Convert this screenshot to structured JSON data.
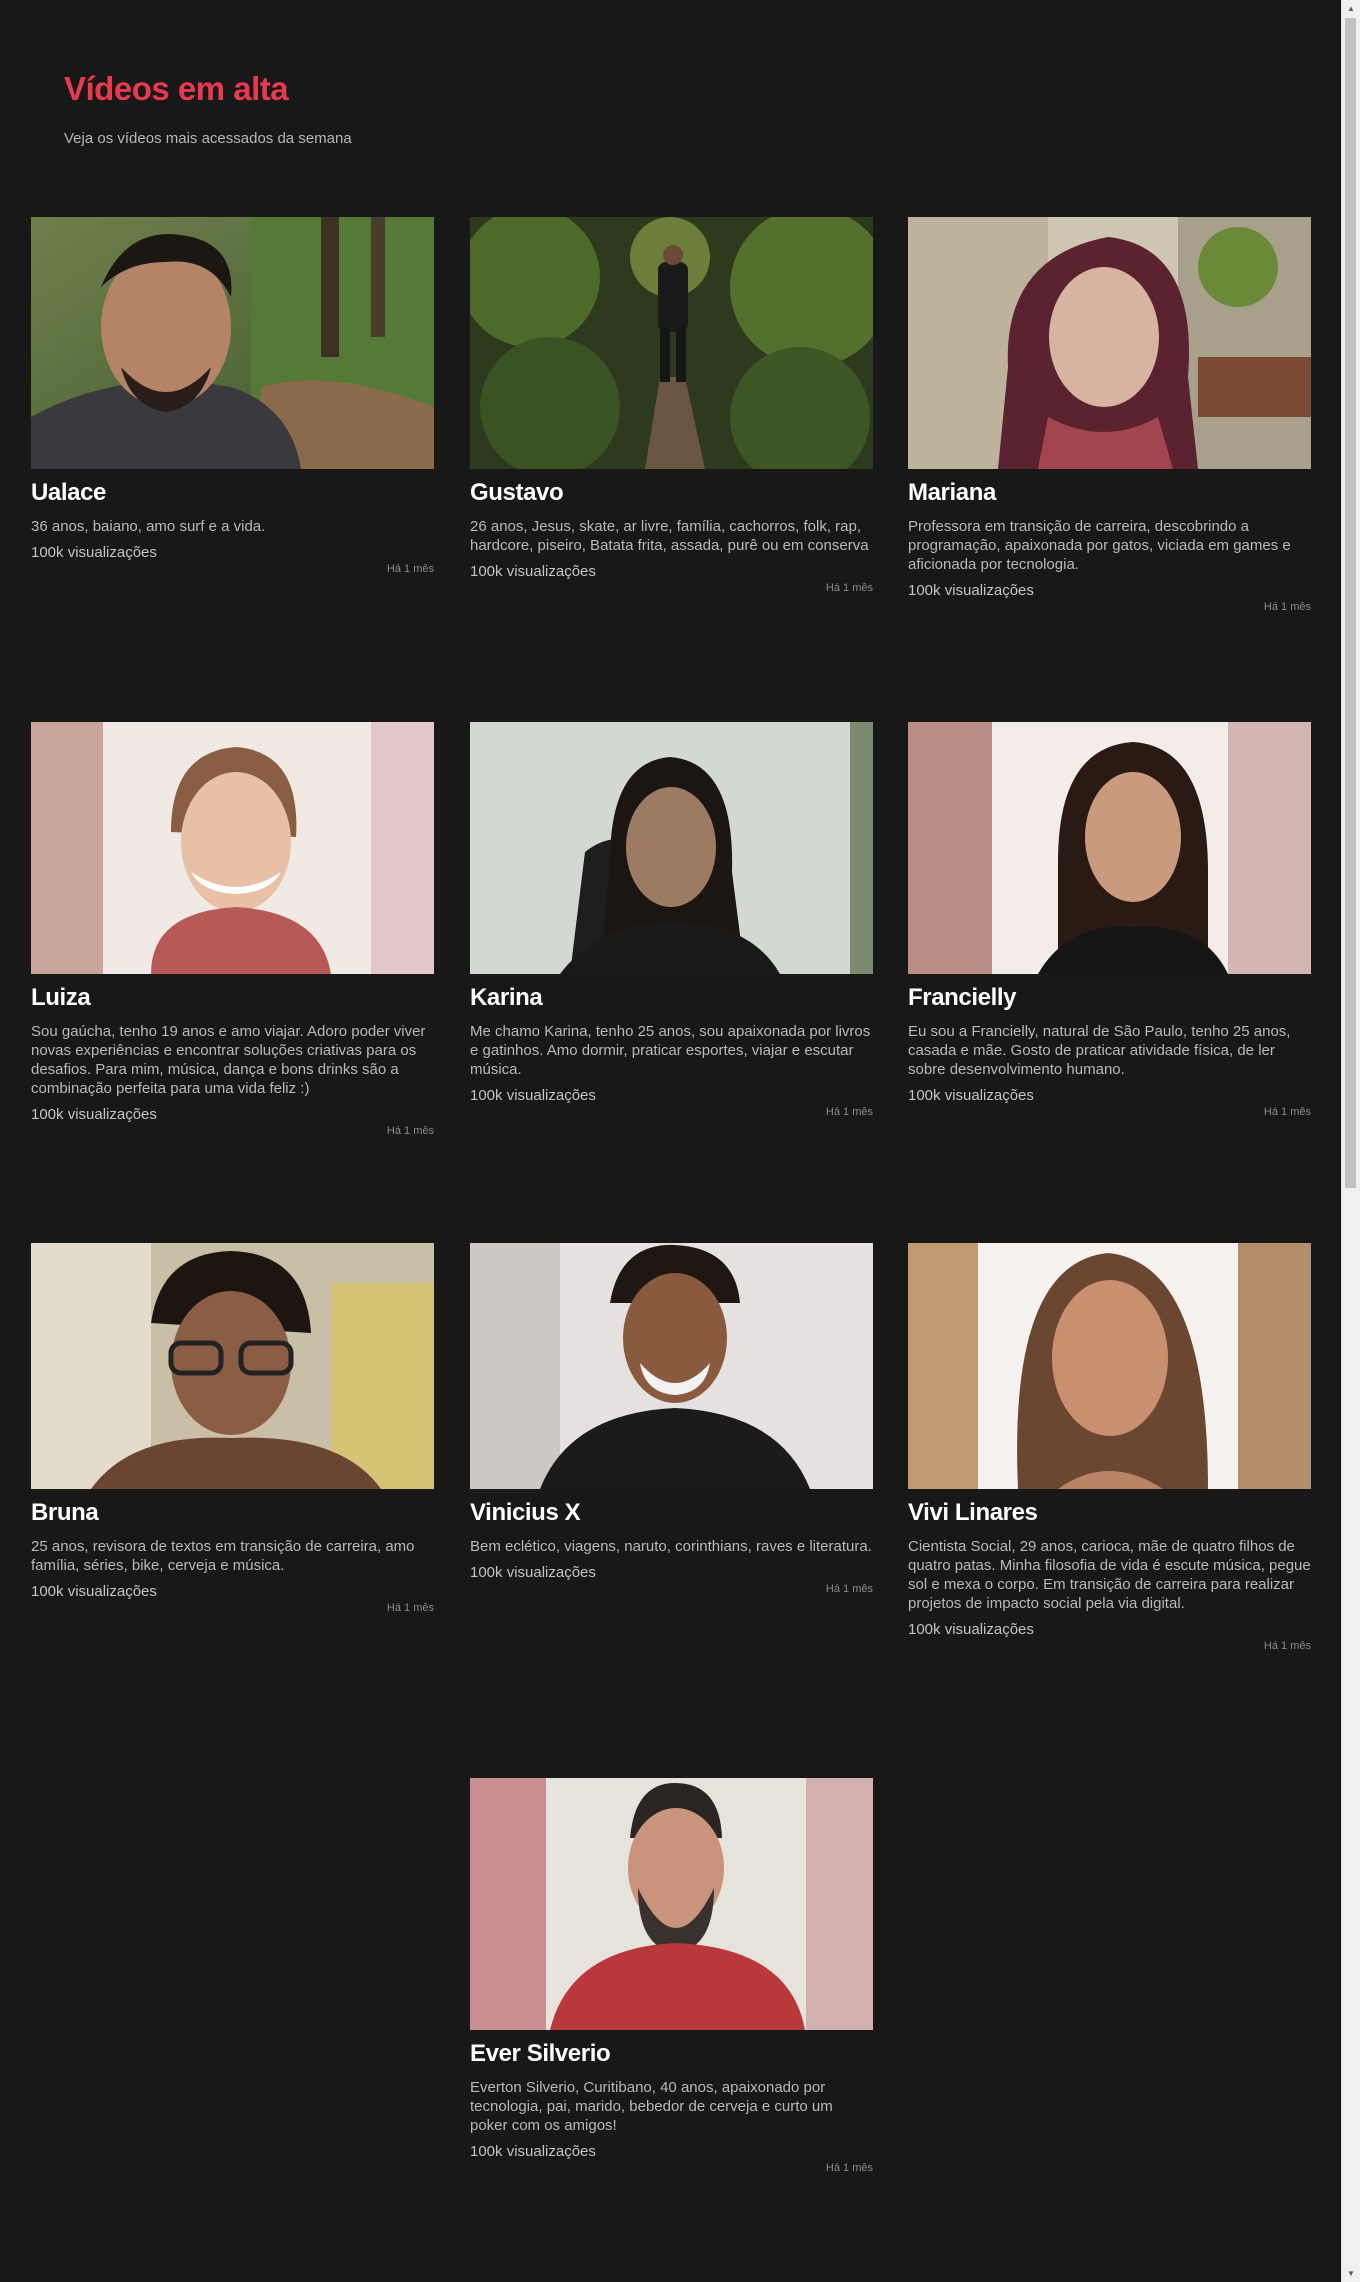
{
  "header": {
    "title": "Vídeos em alta",
    "subtitle": "Veja os vídeos mais acessados da semana"
  },
  "videos": [
    {
      "name": "Ualace",
      "description": "36 anos, baiano, amo surf e a vida.",
      "views": "100k visualizações",
      "time": "Há 1 mês",
      "thumbnail": "man-selfie-forest-thumbnail"
    },
    {
      "name": "Gustavo",
      "description": "26 anos, Jesus, skate, ar livre, família, cachorros, folk, rap, hardcore, piseiro, Batata frita, assada, purê ou em conserva",
      "views": "100k visualizações",
      "time": "Há 1 mês",
      "thumbnail": "hiker-forest-trail-thumbnail"
    },
    {
      "name": "Mariana",
      "description": "Professora em transição de carreira, descobrindo a programação, apaixonada por gatos, viciada em games e aficionada por tecnologia.",
      "views": "100k visualizações",
      "time": "Há 1 mês",
      "thumbnail": "woman-stone-wall-thumbnail"
    },
    {
      "name": "Luiza",
      "description": "Sou gaúcha, tenho 19 anos e amo viajar. Adoro poder viver novas experiências e encontrar soluções criativas para os desafios. Para mim, música, dança e bons drinks são a combinação perfeita para uma vida feliz :)",
      "views": "100k visualizações",
      "time": "Há 1 mês",
      "thumbnail": "woman-red-sweater-thumbnail"
    },
    {
      "name": "Karina",
      "description": "Me chamo Karina, tenho 25 anos, sou apaixonada por livros e gatinhos. Amo dormir, praticar esportes, viajar e escutar música.",
      "views": "100k visualizações",
      "time": "Há 1 mês",
      "thumbnail": "woman-webcam-thumbnail"
    },
    {
      "name": "Francielly",
      "description": "Eu sou a Francielly, natural de São Paulo, tenho 25 anos, casada e mãe. Gosto de praticar atividade física, de ler sobre desenvolvimento humano.",
      "views": "100k visualizações",
      "time": "Há 1 mês",
      "thumbnail": "woman-black-top-thumbnail"
    },
    {
      "name": "Bruna",
      "description": "25 anos, revisora de textos em transição de carreira, amo família, séries, bike, cerveja e música.",
      "views": "100k visualizações",
      "time": "Há 1 mês",
      "thumbnail": "woman-glasses-thumbnail"
    },
    {
      "name": "Vinicius X",
      "description": "Bem eclético, viagens, naruto, corinthians, raves e literatura.",
      "views": "100k visualizações",
      "time": "Há 1 mês",
      "thumbnail": "man-black-hoodie-thumbnail"
    },
    {
      "name": "Vivi Linares",
      "description": "Cientista Social, 29 anos, carioca, mãe de quatro filhos de quatro patas. Minha filosofia de vida é escute música, pegue sol e mexa o corpo. Em transição de carreira para realizar projetos de impacto social pela via digital.",
      "views": "100k visualizações",
      "time": "Há 1 mês",
      "thumbnail": "woman-portrait-thumbnail"
    },
    {
      "name": "Ever Silverio",
      "description": "Everton Silverio, Curitibano, 40 anos, apaixonado por tecnologia, pai, marido, bebedor de cerveja e curto um poker com os amigos!",
      "views": "100k visualizações",
      "time": "Há 1 mês",
      "thumbnail": "man-red-shirt-thumbnail"
    }
  ],
  "colors": {
    "background": "#181818",
    "title_accent": "#e83a4f",
    "name_text": "#ffffff",
    "body_text": "#b9b9b9"
  }
}
